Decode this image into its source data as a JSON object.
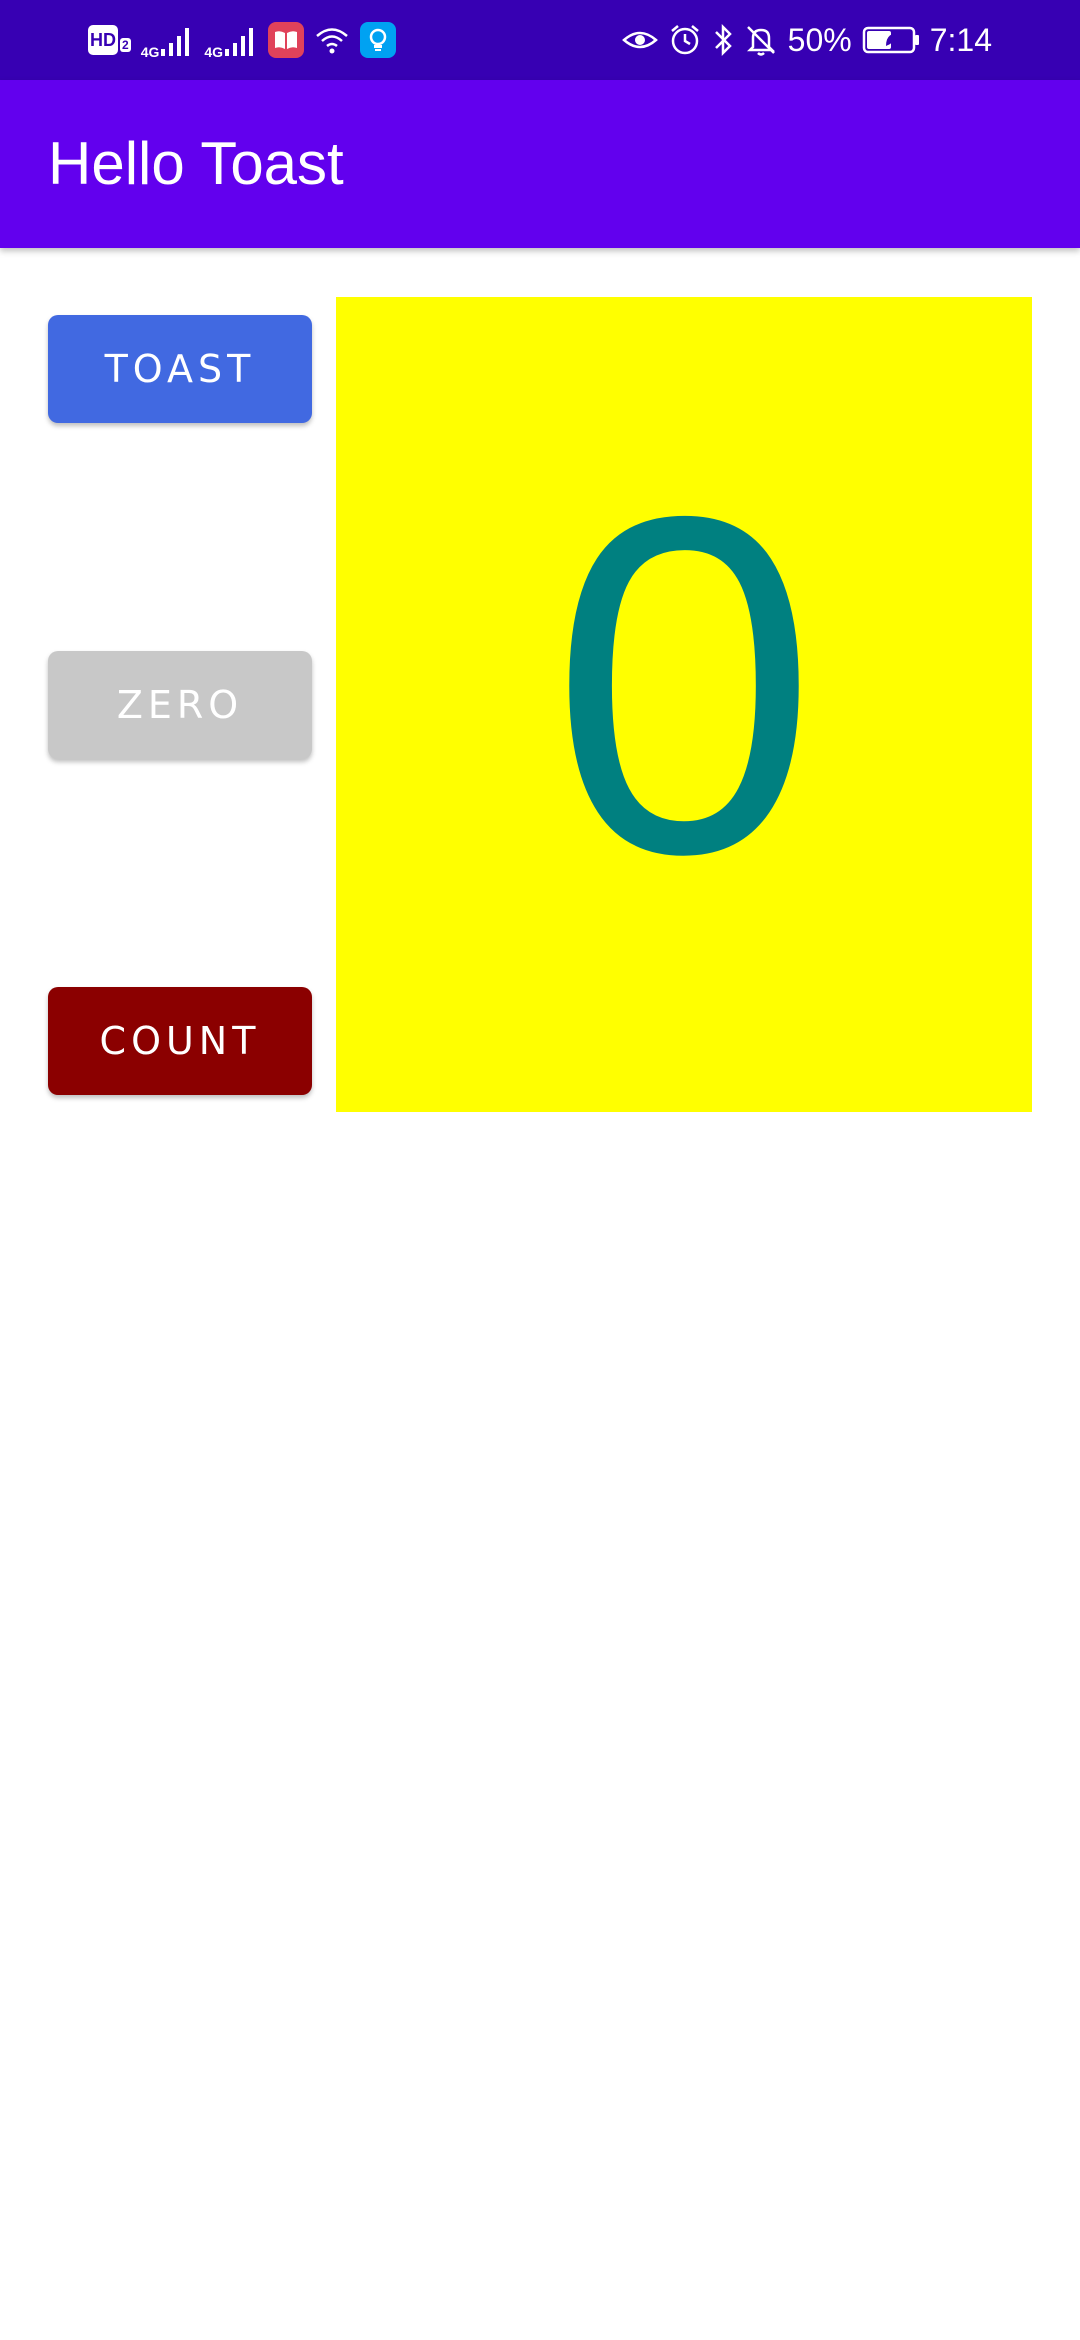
{
  "status_bar": {
    "network_1": "4G",
    "network_2": "4G",
    "battery_percent": "50%",
    "time": "7:14",
    "icons": [
      "hd-icon",
      "signal-icon",
      "signal-icon",
      "book-app-icon",
      "wifi-icon",
      "bulb-app-icon",
      "eye-icon",
      "alarm-icon",
      "bluetooth-icon",
      "mute-icon",
      "battery-icon"
    ],
    "background_color": "#3700b3"
  },
  "app_bar": {
    "title": "Hello Toast",
    "background_color": "#6200ee"
  },
  "buttons": {
    "toast": {
      "label": "TOAST",
      "color": "#4169e1"
    },
    "zero": {
      "label": "ZERO",
      "color": "#c8c8c8"
    },
    "count": {
      "label": "COUNT",
      "color": "#8b0000"
    }
  },
  "counter": {
    "value": "0",
    "background_color": "#ffff00",
    "text_color": "#008080"
  }
}
